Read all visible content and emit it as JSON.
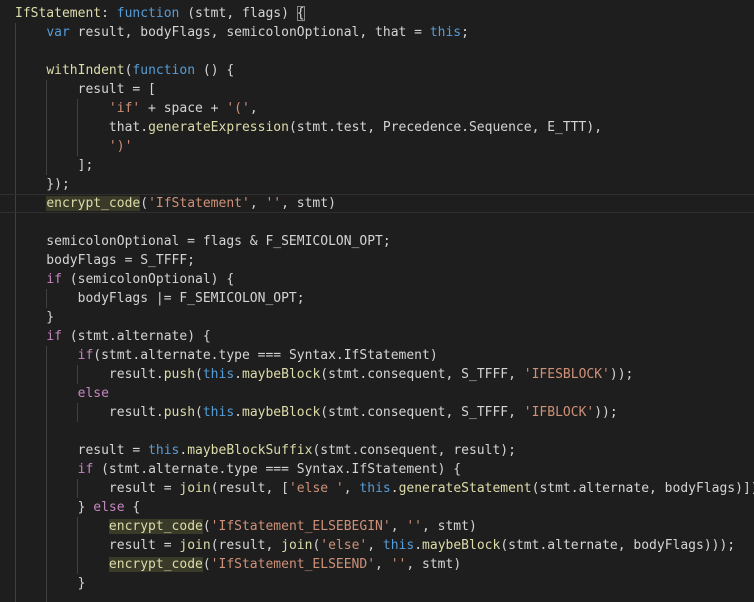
{
  "colors": {
    "background": "#1e1e1e",
    "keyword": "#569cd6",
    "control": "#c586c0",
    "function": "#dcdcaa",
    "variable": "#9cdcfe",
    "string": "#ce9178",
    "class": "#4ec9b0",
    "constant": "#4fc1ff",
    "plain": "#d4d4d4"
  },
  "editor": {
    "current_line_index": 11,
    "lines": [
      [
        [
          "fn",
          "IfStatement"
        ],
        [
          "p",
          ": "
        ],
        [
          "kw",
          "function"
        ],
        [
          "p",
          " (stmt, flags) "
        ],
        [
          "br",
          "{"
        ]
      ],
      [
        [
          "p",
          "    "
        ],
        [
          "kw",
          "var"
        ],
        [
          "p",
          " result, bodyFlags, semicolonOptional, that = "
        ],
        [
          "kw",
          "this"
        ],
        [
          "p",
          ";"
        ]
      ],
      [
        [
          "p",
          ""
        ]
      ],
      [
        [
          "p",
          "    "
        ],
        [
          "fn",
          "withIndent"
        ],
        [
          "p",
          "("
        ],
        [
          "kw",
          "function"
        ],
        [
          "p",
          " () {"
        ]
      ],
      [
        [
          "p",
          "        result = ["
        ]
      ],
      [
        [
          "p",
          "            "
        ],
        [
          "str",
          "'if'"
        ],
        [
          "p",
          " + space + "
        ],
        [
          "str",
          "'('"
        ],
        [
          "p",
          ","
        ]
      ],
      [
        [
          "p",
          "            that."
        ],
        [
          "fn",
          "generateExpression"
        ],
        [
          "p",
          "(stmt.test, Precedence.Sequence, E_TTT),"
        ]
      ],
      [
        [
          "p",
          "            "
        ],
        [
          "str",
          "')'"
        ]
      ],
      [
        [
          "p",
          "        ];"
        ]
      ],
      [
        [
          "p",
          "    });"
        ]
      ],
      [
        [
          "p",
          "    "
        ],
        [
          "hl",
          "encrypt_code"
        ],
        [
          "p",
          "("
        ],
        [
          "str",
          "'IfStatement'"
        ],
        [
          "p",
          ", "
        ],
        [
          "str",
          "''"
        ],
        [
          "p",
          ", stmt)"
        ]
      ],
      [
        [
          "p",
          ""
        ]
      ],
      [
        [
          "p",
          "    semicolonOptional = flags & F_SEMICOLON_OPT;"
        ]
      ],
      [
        [
          "p",
          "    bodyFlags = S_TFFF;"
        ]
      ],
      [
        [
          "p",
          "    "
        ],
        [
          "ctl",
          "if"
        ],
        [
          "p",
          " (semicolonOptional) {"
        ]
      ],
      [
        [
          "p",
          "        bodyFlags |= F_SEMICOLON_OPT;"
        ]
      ],
      [
        [
          "p",
          "    }"
        ]
      ],
      [
        [
          "p",
          "    "
        ],
        [
          "ctl",
          "if"
        ],
        [
          "p",
          " (stmt.alternate) {"
        ]
      ],
      [
        [
          "p",
          "        "
        ],
        [
          "ctl",
          "if"
        ],
        [
          "p",
          "(stmt.alternate.type === Syntax.IfStatement)"
        ]
      ],
      [
        [
          "p",
          "            result."
        ],
        [
          "fn",
          "push"
        ],
        [
          "p",
          "("
        ],
        [
          "kw",
          "this"
        ],
        [
          "p",
          "."
        ],
        [
          "fn",
          "maybeBlock"
        ],
        [
          "p",
          "(stmt.consequent, S_TFFF, "
        ],
        [
          "str",
          "'IFESBLOCK'"
        ],
        [
          "p",
          "));"
        ]
      ],
      [
        [
          "p",
          "        "
        ],
        [
          "ctl",
          "else"
        ]
      ],
      [
        [
          "p",
          "            result."
        ],
        [
          "fn",
          "push"
        ],
        [
          "p",
          "("
        ],
        [
          "kw",
          "this"
        ],
        [
          "p",
          "."
        ],
        [
          "fn",
          "maybeBlock"
        ],
        [
          "p",
          "(stmt.consequent, S_TFFF, "
        ],
        [
          "str",
          "'IFBLOCK'"
        ],
        [
          "p",
          "));"
        ]
      ],
      [
        [
          "p",
          ""
        ]
      ],
      [
        [
          "p",
          "        result = "
        ],
        [
          "kw",
          "this"
        ],
        [
          "p",
          "."
        ],
        [
          "fn",
          "maybeBlockSuffix"
        ],
        [
          "p",
          "(stmt.consequent, result);"
        ]
      ],
      [
        [
          "p",
          "        "
        ],
        [
          "ctl",
          "if"
        ],
        [
          "p",
          " (stmt.alternate.type === Syntax.IfStatement) {"
        ]
      ],
      [
        [
          "p",
          "            result = "
        ],
        [
          "fn",
          "join"
        ],
        [
          "p",
          "(result, ["
        ],
        [
          "str",
          "'else '"
        ],
        [
          "p",
          ", "
        ],
        [
          "kw",
          "this"
        ],
        [
          "p",
          "."
        ],
        [
          "fn",
          "generateStatement"
        ],
        [
          "p",
          "(stmt.alternate, bodyFlags)]);"
        ]
      ],
      [
        [
          "p",
          "        } "
        ],
        [
          "ctl",
          "else"
        ],
        [
          "p",
          " {"
        ]
      ],
      [
        [
          "p",
          "            "
        ],
        [
          "hl",
          "encrypt_code"
        ],
        [
          "p",
          "("
        ],
        [
          "str",
          "'IfStatement_ELSEBEGIN'"
        ],
        [
          "p",
          ", "
        ],
        [
          "str",
          "''"
        ],
        [
          "p",
          ", stmt)"
        ]
      ],
      [
        [
          "p",
          "            result = "
        ],
        [
          "fn",
          "join"
        ],
        [
          "p",
          "(result, "
        ],
        [
          "fn",
          "join"
        ],
        [
          "p",
          "("
        ],
        [
          "str",
          "'else'"
        ],
        [
          "p",
          ", "
        ],
        [
          "kw",
          "this"
        ],
        [
          "p",
          "."
        ],
        [
          "fn",
          "maybeBlock"
        ],
        [
          "p",
          "(stmt.alternate, bodyFlags)));"
        ]
      ],
      [
        [
          "p",
          "            "
        ],
        [
          "hl",
          "encrypt_code"
        ],
        [
          "p",
          "("
        ],
        [
          "str",
          "'IfStatement_ELSEEND'"
        ],
        [
          "p",
          ", "
        ],
        [
          "str",
          "''"
        ],
        [
          "p",
          ", stmt)"
        ]
      ],
      [
        [
          "p",
          "        }"
        ]
      ]
    ]
  }
}
